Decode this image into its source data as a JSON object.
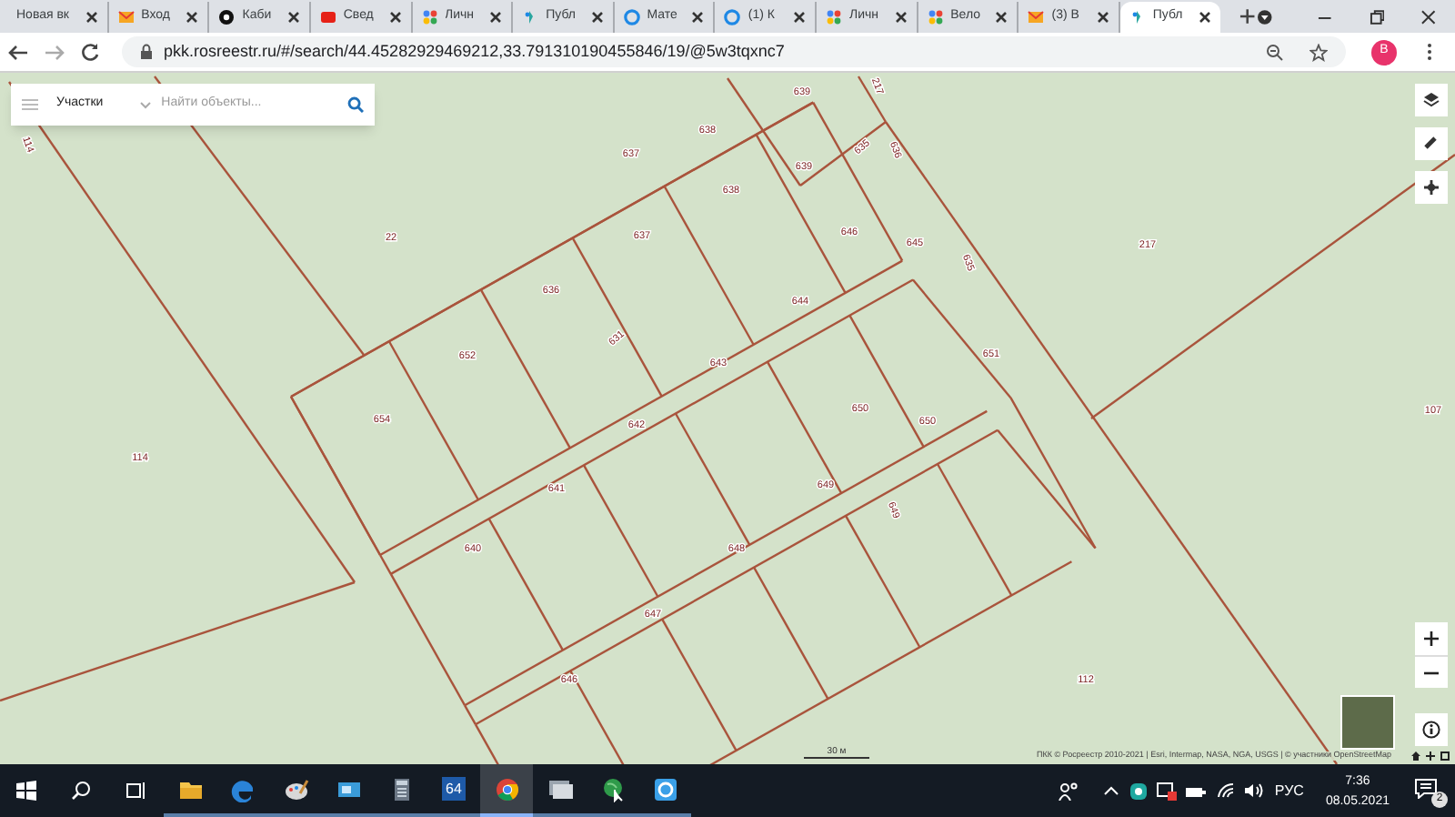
{
  "tabs": [
    {
      "title": "Новая вк",
      "kind": "plain",
      "selected": false
    },
    {
      "title": "Вход",
      "kind": "mail",
      "selected": false
    },
    {
      "title": "Каби",
      "kind": "circle",
      "selected": false
    },
    {
      "title": "Свед",
      "kind": "video",
      "selected": false
    },
    {
      "title": "Личн",
      "kind": "dots",
      "selected": false
    },
    {
      "title": "Публ",
      "kind": "pin",
      "selected": false
    },
    {
      "title": "Мате",
      "kind": "ring",
      "selected": false
    },
    {
      "title": "(1) К",
      "kind": "ring",
      "selected": false
    },
    {
      "title": "Личн",
      "kind": "dots",
      "selected": false
    },
    {
      "title": "Вело",
      "kind": "dots",
      "selected": false
    },
    {
      "title": "(3) В",
      "kind": "mail",
      "selected": false
    },
    {
      "title": "Публ",
      "kind": "pin",
      "selected": true
    }
  ],
  "address_bar": {
    "url": "pkk.rosreestr.ru/#/search/44.45282929469212,33.791310190455846/19/@5w3tqxnc7"
  },
  "profile": {
    "initial": "В"
  },
  "search": {
    "category": "Участки",
    "placeholder": "Найти объекты..."
  },
  "map": {
    "parcel_labels": [
      "22",
      "114",
      "217",
      "107",
      "112",
      "638",
      "637",
      "639",
      "639",
      "217",
      "635",
      "636",
      "637",
      "638",
      "636",
      "652",
      "654",
      "631",
      "646",
      "645",
      "635",
      "644",
      "643",
      "651",
      "642",
      "650",
      "650",
      "641",
      "649",
      "649",
      "640",
      "648",
      "647",
      "646",
      "114"
    ],
    "scale": "30 м",
    "attribution": "ПКК © Росреестр 2010-2021 | Esri, Intermap, NASA, NGA, USGS | © участники OpenStreetMap"
  },
  "taskbar": {
    "apps": [
      {
        "kind": "folder",
        "active": false
      },
      {
        "kind": "edge",
        "active": false
      },
      {
        "kind": "paint",
        "active": false
      },
      {
        "kind": "screen",
        "active": false
      },
      {
        "kind": "calculator",
        "active": false
      },
      {
        "kind": "label",
        "label": "64",
        "active": false
      },
      {
        "kind": "chrome",
        "active": true
      },
      {
        "kind": "monitor",
        "active": false
      },
      {
        "kind": "globe",
        "active": false
      },
      {
        "kind": "sync",
        "active": false
      }
    ]
  },
  "tray": {
    "language": "РУС",
    "time": "7:36",
    "date": "08.05.2021",
    "notifications": "2"
  }
}
